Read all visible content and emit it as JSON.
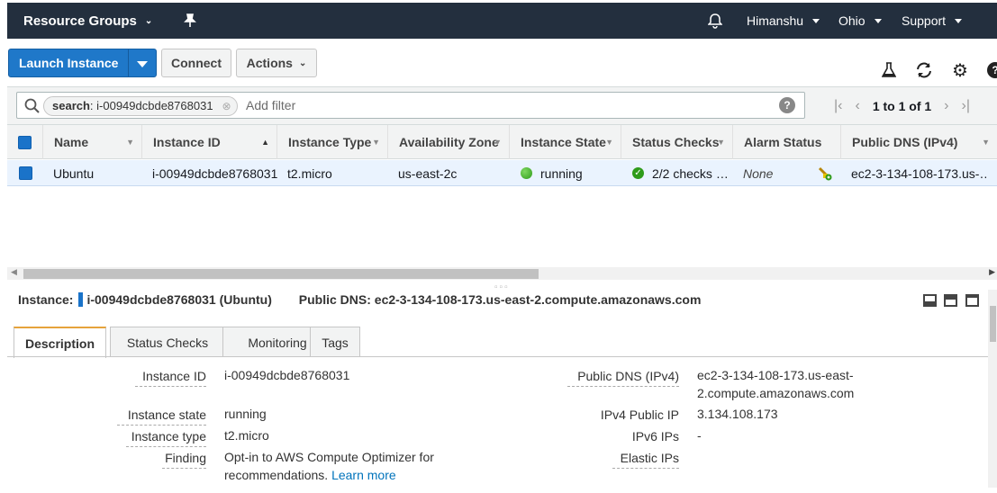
{
  "nav": {
    "brand": "Resource Groups",
    "user": "Himanshu",
    "region": "Ohio",
    "support": "Support"
  },
  "toolbar": {
    "launch_label": "Launch Instance",
    "connect_label": "Connect",
    "actions_label": "Actions"
  },
  "filter": {
    "token_key": "search",
    "token_value": ": i-00949dcbde8768031",
    "placeholder": "Add filter"
  },
  "pager": {
    "text": "1 to 1 of 1"
  },
  "columns": [
    "Name",
    "Instance ID",
    "Instance Type",
    "Availability Zone",
    "Instance State",
    "Status Checks",
    "Alarm Status",
    "Public DNS (IPv4)"
  ],
  "row": {
    "name": "Ubuntu",
    "instance_id": "i-00949dcbde8768031",
    "instance_type": "t2.micro",
    "az": "us-east-2c",
    "state": "running",
    "status_checks": "2/2 checks …",
    "alarm": "None",
    "dns": "ec2-3-134-108-173.us-…"
  },
  "details": {
    "instance_label": "Instance:",
    "instance_value": "i-00949dcbde8768031 (Ubuntu)",
    "dns_label": "Public DNS:",
    "dns_value": "ec2-3-134-108-173.us-east-2.compute.amazonaws.com",
    "tabs": [
      "Description",
      "Status Checks",
      "Monitoring",
      "Tags"
    ],
    "fields": {
      "instance_id_label": "Instance ID",
      "instance_id": "i-00949dcbde8768031",
      "state_label": "Instance state",
      "state": "running",
      "type_label": "Instance type",
      "type": "t2.micro",
      "finding_label": "Finding",
      "finding_line1": "Opt-in to AWS Compute Optimizer for",
      "finding_line2": "recommendations.",
      "learn_more": "Learn more",
      "public_dns_label": "Public DNS (IPv4)",
      "public_dns_line1": "ec2-3-134-108-173.us-east-",
      "public_dns_line2": "2.compute.amazonaws.com",
      "ipv4_label": "IPv4 Public IP",
      "ipv4": "3.134.108.173",
      "ipv6_label": "IPv6 IPs",
      "ipv6": "-",
      "elastic_label": "Elastic IPs"
    }
  },
  "colors": {
    "nav_bg": "#232f3e",
    "primary": "#1f78c9",
    "row_selected": "#eaf3fe",
    "running": "#2e9b1a",
    "tab_accent": "#e6a33b"
  }
}
